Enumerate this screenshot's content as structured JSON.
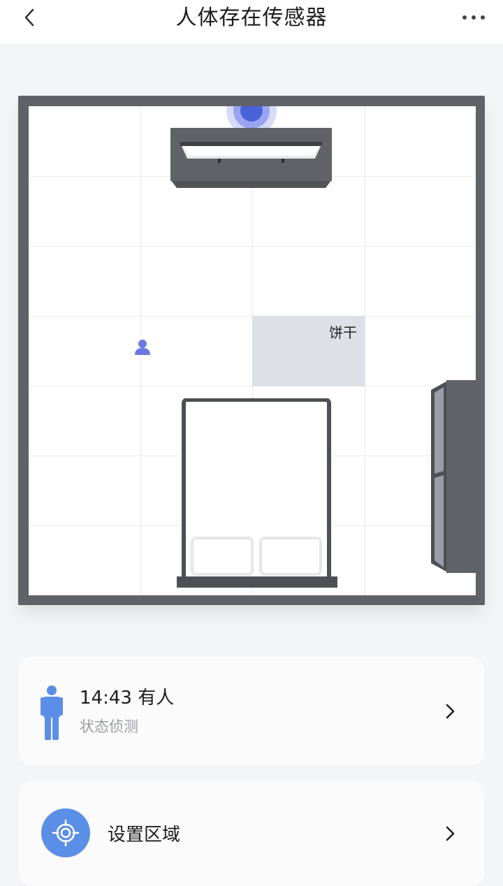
{
  "header": {
    "title": "人体存在传感器"
  },
  "room": {
    "zone_label": "饼干"
  },
  "status_card": {
    "status": "14:43 有人",
    "subtitle": "状态侦测"
  },
  "area_card": {
    "label": "设置区域"
  },
  "icons": {
    "back": "chevron-left-icon",
    "more": "more-dots-icon",
    "sensor": "radar-sensor-icon",
    "person": "person-icon",
    "target": "target-icon",
    "chevron": "chevron-right-icon"
  },
  "colors": {
    "accent_blue": "#5b8ee6",
    "sensor_blue": "#4a62d8",
    "wall": "#5f6266",
    "zone": "#dde0e7"
  }
}
